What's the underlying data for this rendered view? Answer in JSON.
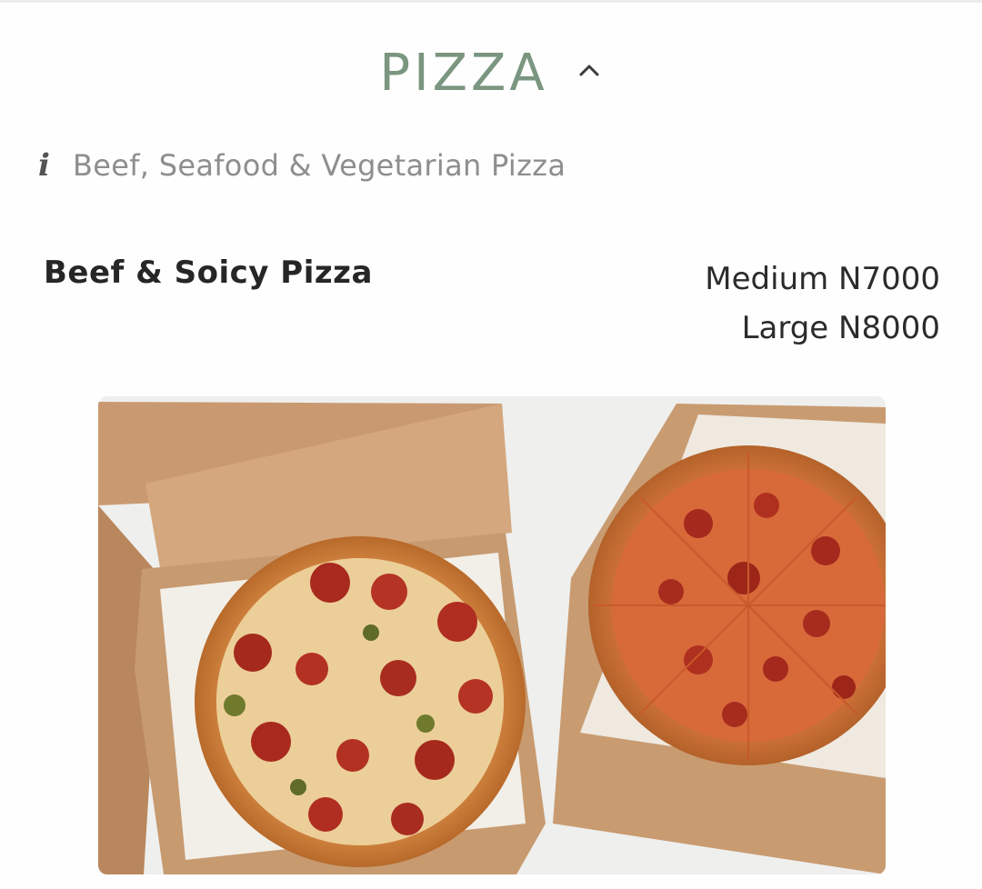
{
  "section": {
    "title": "PIZZA",
    "expand_icon": "chevron-up-icon"
  },
  "info": {
    "icon": "info-icon",
    "icon_glyph": "i",
    "text": "Beef, Seafood & Vegetarian Pizza"
  },
  "items": [
    {
      "name": "Beef & Soicy Pizza",
      "prices": [
        "Medium N7000",
        "Large N8000"
      ],
      "image": "two-pizzas-in-boxes-photo"
    }
  ],
  "colors": {
    "accent": "#7a9680",
    "muted_text": "#8e8e8e",
    "body_text": "#262626"
  }
}
